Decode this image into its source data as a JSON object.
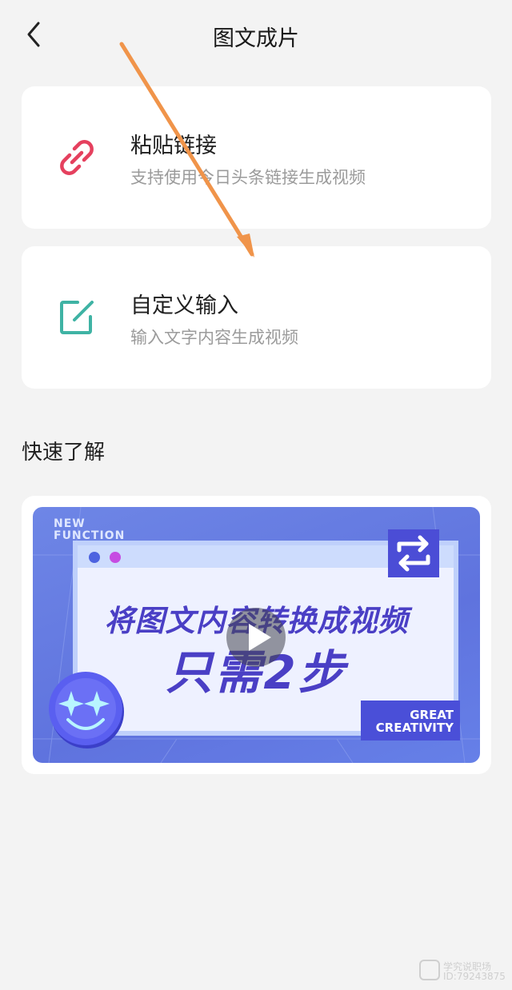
{
  "header": {
    "title": "图文成片"
  },
  "options": [
    {
      "title": "粘贴链接",
      "subtitle": "支持使用今日头条链接生成视频",
      "icon": "link-icon",
      "icon_color": "#e5405e"
    },
    {
      "title": "自定义输入",
      "subtitle": "输入文字内容生成视频",
      "icon": "edit-icon",
      "icon_color": "#3fb3a4"
    }
  ],
  "quick_learn": {
    "title": "快速了解",
    "thumbnail": {
      "corner_label_lines": [
        "NEW",
        "FUNCTION"
      ],
      "headline_1": "将图文内容转换成视频",
      "headline_2": "只需2步",
      "badge_lines": [
        "GREAT",
        "CREATIVITY"
      ]
    }
  },
  "watermark": {
    "name": "学究说职场",
    "id": "ID:79243875"
  },
  "colors": {
    "background": "#f3f3f3",
    "annotation_arrow": "#f0944a",
    "thumbnail_accent": "#4a3fc5"
  }
}
